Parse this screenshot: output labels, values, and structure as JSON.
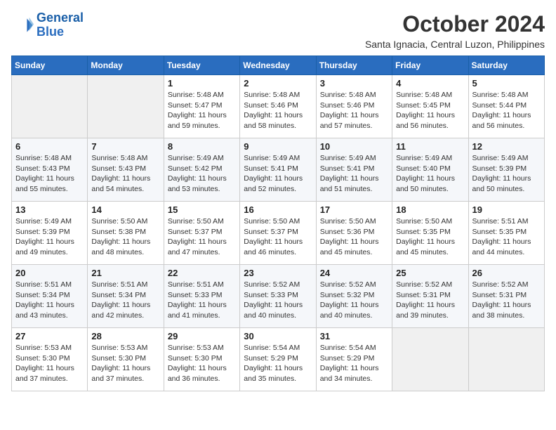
{
  "logo": {
    "line1": "General",
    "line2": "Blue"
  },
  "title": "October 2024",
  "subtitle": "Santa Ignacia, Central Luzon, Philippines",
  "weekdays": [
    "Sunday",
    "Monday",
    "Tuesday",
    "Wednesday",
    "Thursday",
    "Friday",
    "Saturday"
  ],
  "weeks": [
    [
      {
        "day": "",
        "info": ""
      },
      {
        "day": "",
        "info": ""
      },
      {
        "day": "1",
        "info": "Sunrise: 5:48 AM\nSunset: 5:47 PM\nDaylight: 11 hours and 59 minutes."
      },
      {
        "day": "2",
        "info": "Sunrise: 5:48 AM\nSunset: 5:46 PM\nDaylight: 11 hours and 58 minutes."
      },
      {
        "day": "3",
        "info": "Sunrise: 5:48 AM\nSunset: 5:46 PM\nDaylight: 11 hours and 57 minutes."
      },
      {
        "day": "4",
        "info": "Sunrise: 5:48 AM\nSunset: 5:45 PM\nDaylight: 11 hours and 56 minutes."
      },
      {
        "day": "5",
        "info": "Sunrise: 5:48 AM\nSunset: 5:44 PM\nDaylight: 11 hours and 56 minutes."
      }
    ],
    [
      {
        "day": "6",
        "info": "Sunrise: 5:48 AM\nSunset: 5:43 PM\nDaylight: 11 hours and 55 minutes."
      },
      {
        "day": "7",
        "info": "Sunrise: 5:48 AM\nSunset: 5:43 PM\nDaylight: 11 hours and 54 minutes."
      },
      {
        "day": "8",
        "info": "Sunrise: 5:49 AM\nSunset: 5:42 PM\nDaylight: 11 hours and 53 minutes."
      },
      {
        "day": "9",
        "info": "Sunrise: 5:49 AM\nSunset: 5:41 PM\nDaylight: 11 hours and 52 minutes."
      },
      {
        "day": "10",
        "info": "Sunrise: 5:49 AM\nSunset: 5:41 PM\nDaylight: 11 hours and 51 minutes."
      },
      {
        "day": "11",
        "info": "Sunrise: 5:49 AM\nSunset: 5:40 PM\nDaylight: 11 hours and 50 minutes."
      },
      {
        "day": "12",
        "info": "Sunrise: 5:49 AM\nSunset: 5:39 PM\nDaylight: 11 hours and 50 minutes."
      }
    ],
    [
      {
        "day": "13",
        "info": "Sunrise: 5:49 AM\nSunset: 5:39 PM\nDaylight: 11 hours and 49 minutes."
      },
      {
        "day": "14",
        "info": "Sunrise: 5:50 AM\nSunset: 5:38 PM\nDaylight: 11 hours and 48 minutes."
      },
      {
        "day": "15",
        "info": "Sunrise: 5:50 AM\nSunset: 5:37 PM\nDaylight: 11 hours and 47 minutes."
      },
      {
        "day": "16",
        "info": "Sunrise: 5:50 AM\nSunset: 5:37 PM\nDaylight: 11 hours and 46 minutes."
      },
      {
        "day": "17",
        "info": "Sunrise: 5:50 AM\nSunset: 5:36 PM\nDaylight: 11 hours and 45 minutes."
      },
      {
        "day": "18",
        "info": "Sunrise: 5:50 AM\nSunset: 5:35 PM\nDaylight: 11 hours and 45 minutes."
      },
      {
        "day": "19",
        "info": "Sunrise: 5:51 AM\nSunset: 5:35 PM\nDaylight: 11 hours and 44 minutes."
      }
    ],
    [
      {
        "day": "20",
        "info": "Sunrise: 5:51 AM\nSunset: 5:34 PM\nDaylight: 11 hours and 43 minutes."
      },
      {
        "day": "21",
        "info": "Sunrise: 5:51 AM\nSunset: 5:34 PM\nDaylight: 11 hours and 42 minutes."
      },
      {
        "day": "22",
        "info": "Sunrise: 5:51 AM\nSunset: 5:33 PM\nDaylight: 11 hours and 41 minutes."
      },
      {
        "day": "23",
        "info": "Sunrise: 5:52 AM\nSunset: 5:33 PM\nDaylight: 11 hours and 40 minutes."
      },
      {
        "day": "24",
        "info": "Sunrise: 5:52 AM\nSunset: 5:32 PM\nDaylight: 11 hours and 40 minutes."
      },
      {
        "day": "25",
        "info": "Sunrise: 5:52 AM\nSunset: 5:31 PM\nDaylight: 11 hours and 39 minutes."
      },
      {
        "day": "26",
        "info": "Sunrise: 5:52 AM\nSunset: 5:31 PM\nDaylight: 11 hours and 38 minutes."
      }
    ],
    [
      {
        "day": "27",
        "info": "Sunrise: 5:53 AM\nSunset: 5:30 PM\nDaylight: 11 hours and 37 minutes."
      },
      {
        "day": "28",
        "info": "Sunrise: 5:53 AM\nSunset: 5:30 PM\nDaylight: 11 hours and 37 minutes."
      },
      {
        "day": "29",
        "info": "Sunrise: 5:53 AM\nSunset: 5:30 PM\nDaylight: 11 hours and 36 minutes."
      },
      {
        "day": "30",
        "info": "Sunrise: 5:54 AM\nSunset: 5:29 PM\nDaylight: 11 hours and 35 minutes."
      },
      {
        "day": "31",
        "info": "Sunrise: 5:54 AM\nSunset: 5:29 PM\nDaylight: 11 hours and 34 minutes."
      },
      {
        "day": "",
        "info": ""
      },
      {
        "day": "",
        "info": ""
      }
    ]
  ]
}
